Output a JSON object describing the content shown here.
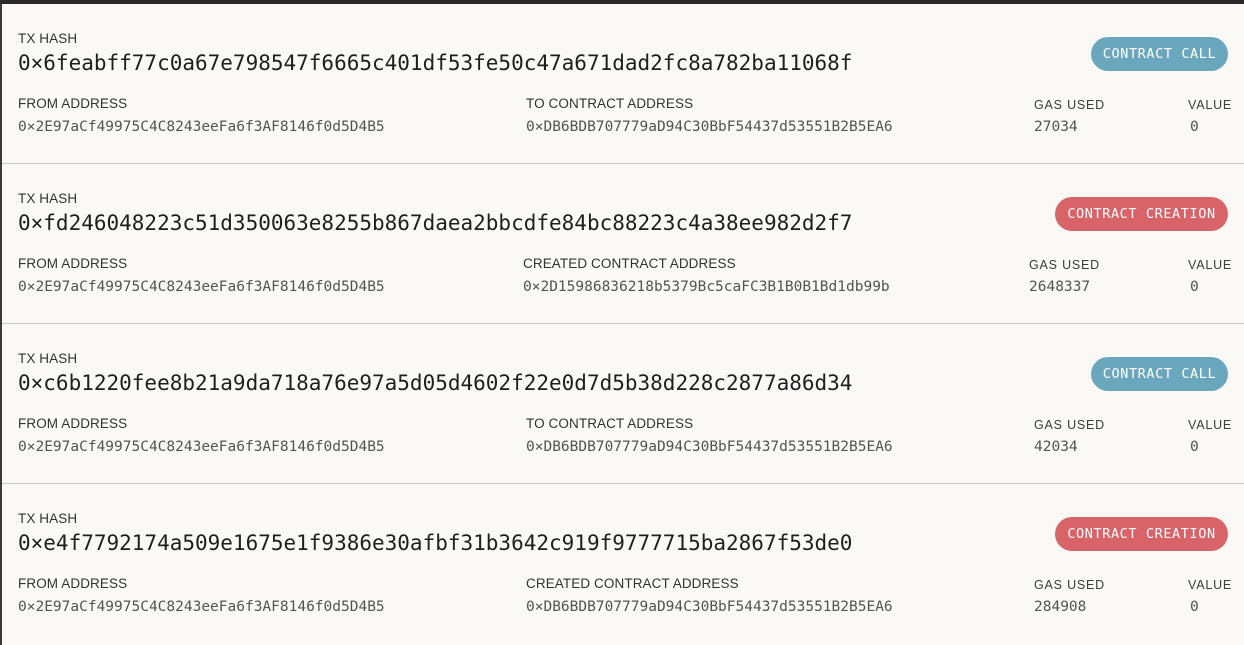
{
  "labels": {
    "tx_hash": "TX HASH",
    "from_address": "FROM ADDRESS",
    "gas_used": "GAS USED",
    "value": "VALUE"
  },
  "colors": {
    "contract_call": "#6aa7bd",
    "contract_creation": "#d8646a"
  },
  "transactions": [
    {
      "hash": "0×6feabff77c0a67e798547f6665c401df53fe50c47a671dad2fc8a782ba11068f",
      "type": "CONTRACT CALL",
      "from": "0×2E97aCf49975C4C8243eeFa6f3AF8146f0d5D4B5",
      "to_label": "TO CONTRACT ADDRESS",
      "to": "0×DB6BDB707779aD94C30BbF54437d53551B2B5EA6",
      "gas_used": "27034",
      "value": "0"
    },
    {
      "hash": "0×fd246048223c51d350063e8255b867daea2bbcdfe84bc88223c4a38ee982d2f7",
      "type": "CONTRACT CREATION",
      "from": "0×2E97aCf49975C4C8243eeFa6f3AF8146f0d5D4B5",
      "to_label": "CREATED CONTRACT ADDRESS",
      "to": "0×2D15986836218b5379Bc5caFC3B1B0B1Bd1db99b",
      "gas_used": "2648337",
      "value": "0"
    },
    {
      "hash": "0×c6b1220fee8b21a9da718a76e97a5d05d4602f22e0d7d5b38d228c2877a86d34",
      "type": "CONTRACT CALL",
      "from": "0×2E97aCf49975C4C8243eeFa6f3AF8146f0d5D4B5",
      "to_label": "TO CONTRACT ADDRESS",
      "to": "0×DB6BDB707779aD94C30BbF54437d53551B2B5EA6",
      "gas_used": "42034",
      "value": "0"
    },
    {
      "hash": "0×e4f7792174a509e1675e1f9386e30afbf31b3642c919f9777715ba2867f53de0",
      "type": "CONTRACT CREATION",
      "from": "0×2E97aCf49975C4C8243eeFa6f3AF8146f0d5D4B5",
      "to_label": "CREATED CONTRACT ADDRESS",
      "to": "0×DB6BDB707779aD94C30BbF54437d53551B2B5EA6",
      "gas_used": "284908",
      "value": "0"
    }
  ]
}
